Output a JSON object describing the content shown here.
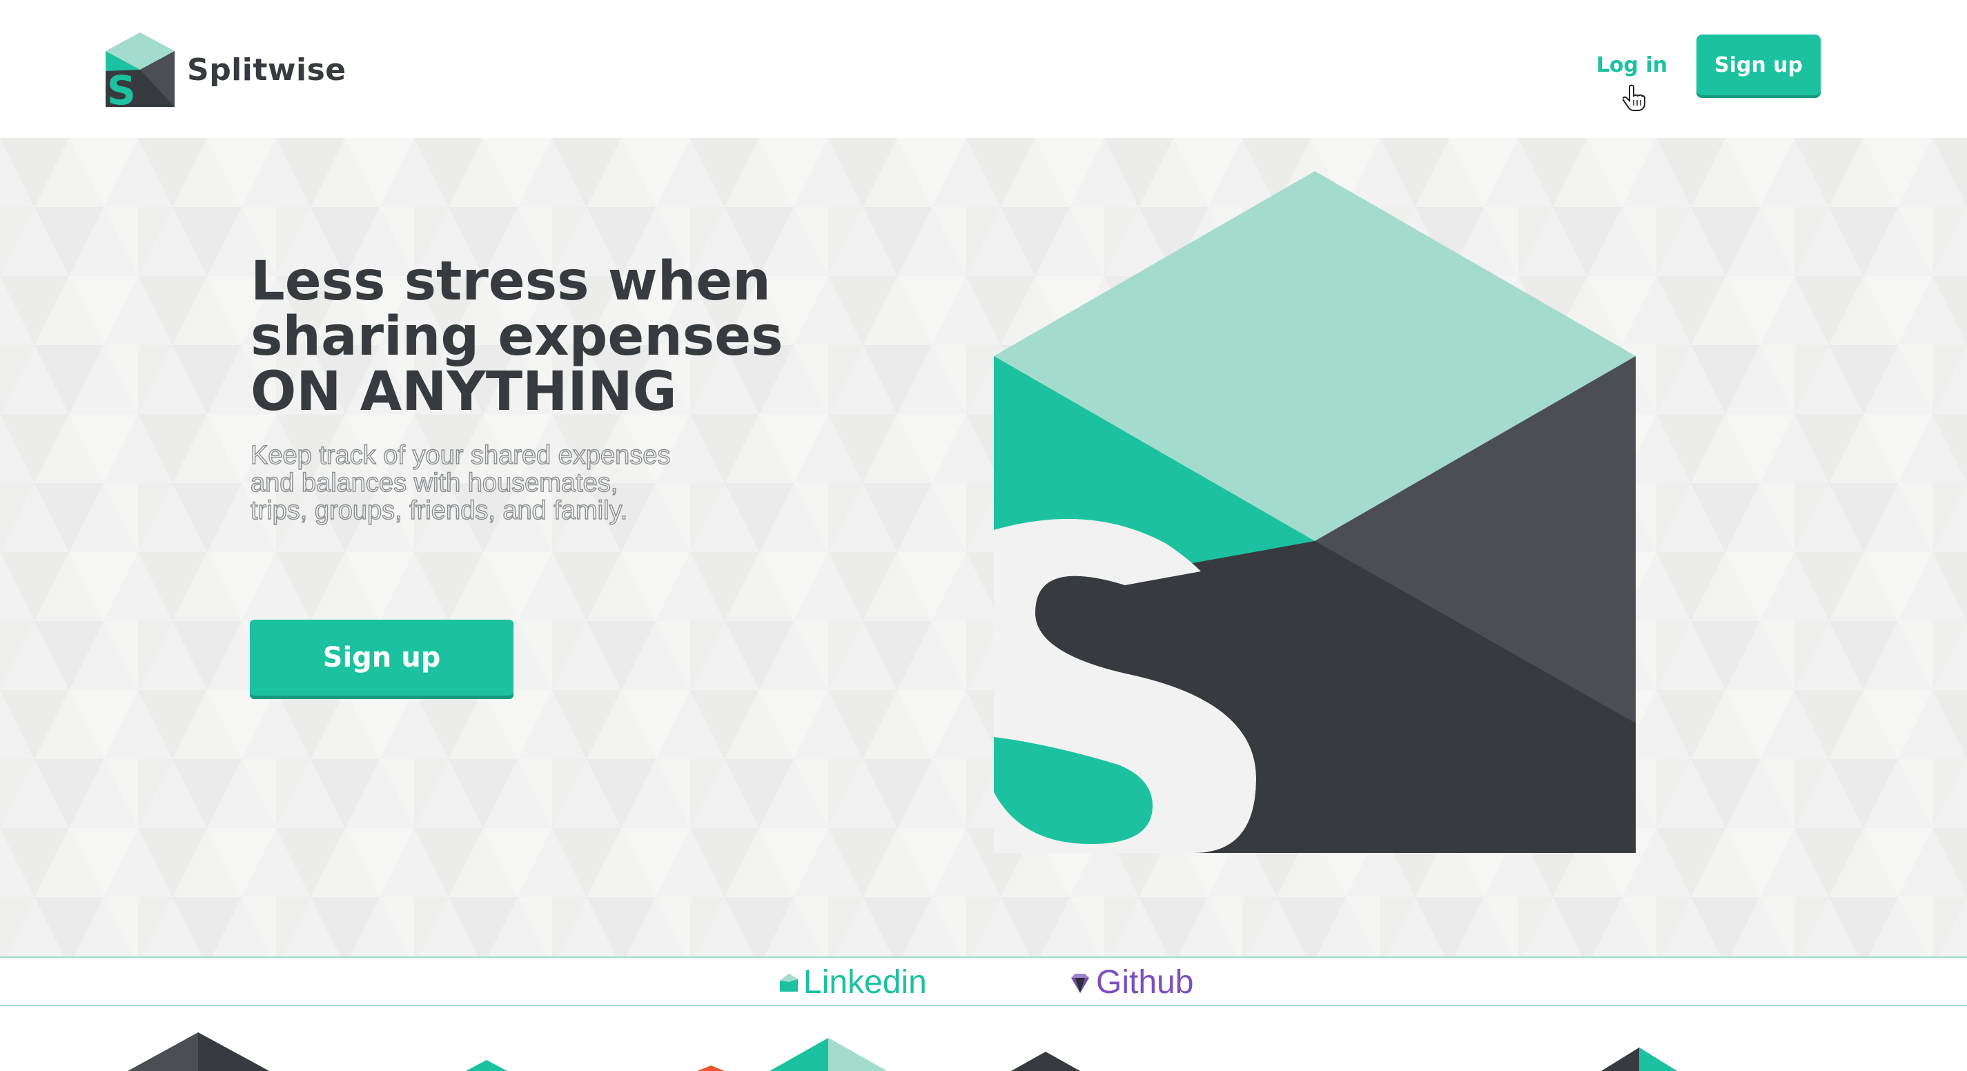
{
  "brand": {
    "name": "Splitwise",
    "logo_icon": "splitwise-logo-icon"
  },
  "nav": {
    "login_label": "Log in",
    "signup_label": "Sign up"
  },
  "hero": {
    "headline": [
      "Less stress when",
      "sharing expenses",
      "ON ANYTHING"
    ],
    "subcopy": [
      "Keep track of your shared expenses",
      "and balances with housemates,",
      "trips, groups, friends, and family."
    ],
    "signup_label": "Sign up",
    "logo_icon": "splitwise-large-logo-icon"
  },
  "links": {
    "linkedin_label": "Linkedin",
    "linkedin_icon": "house-icon",
    "github_label": "Github",
    "github_icon": "gem-icon"
  },
  "colors": {
    "accent": "#1cc29f",
    "accent_light": "#a3dccd",
    "dark": "#373b3f",
    "background": "#f1f2f1",
    "github": "#7b4fc0"
  }
}
